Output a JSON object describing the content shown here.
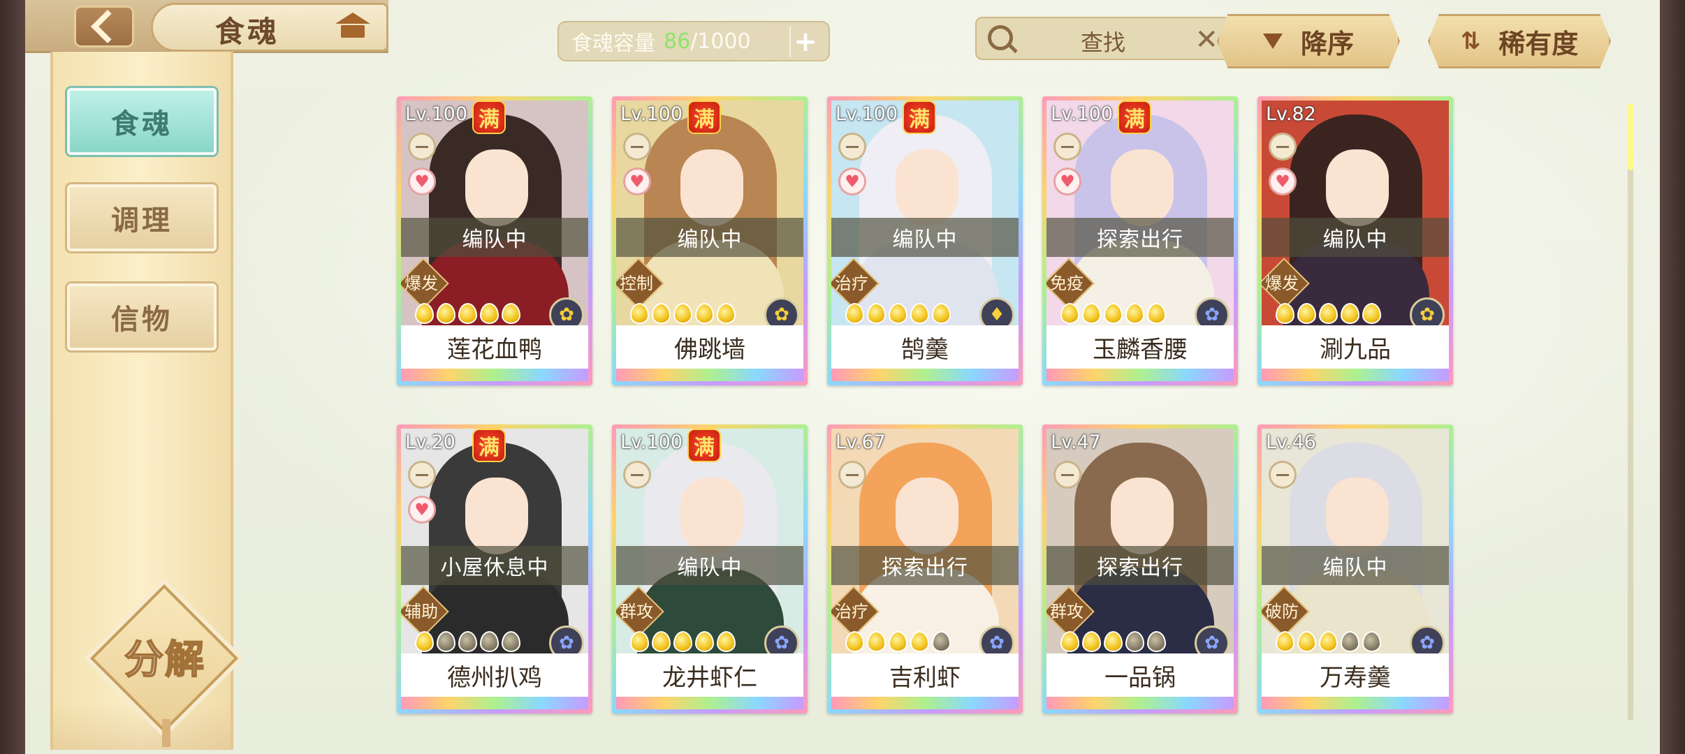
{
  "header": {
    "title": "食魂",
    "capacity_label": "食魂容量",
    "capacity_current": "86",
    "capacity_max": "/1000",
    "capacity_add": "+",
    "search_text": "查找",
    "search_clear": "✕",
    "sort_order_label": "降序",
    "sort_key_label": "稀有度",
    "sort_key_icon": "⇅"
  },
  "sidebar": {
    "items": [
      {
        "label": "食魂"
      },
      {
        "label": "调理"
      },
      {
        "label": "信物"
      }
    ],
    "decompose_label": "分解"
  },
  "cards": [
    {
      "level": "Lv.100",
      "max": "满",
      "status": "编队中",
      "role": "爆发",
      "name": "莲花血鸭",
      "stars_filled": 5,
      "element": "gold",
      "element_glyph": "✿",
      "heart": true
    },
    {
      "level": "Lv.100",
      "max": "满",
      "status": "编队中",
      "role": "控制",
      "name": "佛跳墙",
      "stars_filled": 5,
      "element": "gold",
      "element_glyph": "✿",
      "heart": true
    },
    {
      "level": "Lv.100",
      "max": "满",
      "status": "编队中",
      "role": "治疗",
      "name": "鹄羹",
      "stars_filled": 5,
      "element": "gold",
      "element_glyph": "♦",
      "heart": true
    },
    {
      "level": "Lv.100",
      "max": "满",
      "status": "探索出行",
      "role": "免疫",
      "name": "玉麟香腰",
      "stars_filled": 5,
      "element": "blue",
      "element_glyph": "✿",
      "heart": true
    },
    {
      "level": "Lv.82",
      "max": "",
      "status": "编队中",
      "role": "爆发",
      "name": "涮九品",
      "stars_filled": 5,
      "element": "gold",
      "element_glyph": "✿",
      "heart": true
    },
    {
      "level": "Lv.20",
      "max": "满",
      "status": "小屋休息中",
      "role": "辅助",
      "name": "德州扒鸡",
      "stars_filled": 1,
      "element": "blue",
      "element_glyph": "✿",
      "heart": true
    },
    {
      "level": "Lv.100",
      "max": "满",
      "status": "编队中",
      "role": "群攻",
      "name": "龙井虾仁",
      "stars_filled": 5,
      "element": "blue",
      "element_glyph": "✿",
      "heart": false
    },
    {
      "level": "Lv.67",
      "max": "",
      "status": "探索出行",
      "role": "治疗",
      "name": "吉利虾",
      "stars_filled": 4,
      "element": "blue",
      "element_glyph": "✿",
      "heart": false
    },
    {
      "level": "Lv.47",
      "max": "",
      "status": "探索出行",
      "role": "群攻",
      "name": "一品锅",
      "stars_filled": 3,
      "element": "blue",
      "element_glyph": "✿",
      "heart": false
    },
    {
      "level": "Lv.46",
      "max": "",
      "status": "编队中",
      "role": "破防",
      "name": "万寿羹",
      "stars_filled": 3,
      "element": "blue",
      "element_glyph": "✿",
      "heart": false
    }
  ],
  "palette": {
    "hair": [
      "#3a2a26",
      "#b98552",
      "#eeeef4",
      "#c9c3ea",
      "#3b2420",
      "#3a3a3a",
      "#eaeaee",
      "#f3a35a",
      "#8a6a4e",
      "#dcdce4"
    ],
    "robe": [
      "#8a1e24",
      "#f1e3b8",
      "#dfe4ef",
      "#f4f0e6",
      "#3a2a3e",
      "#2b2b2b",
      "#2e4a3a",
      "#f8f0e4",
      "#2b2d44",
      "#eae4cc"
    ],
    "bg": [
      "#d6c4c4",
      "#e8d8a0",
      "#c6e6f2",
      "#f2d8e8",
      "#c84a36",
      "#e6e6e6",
      "#d8ece6",
      "#f3d9b6",
      "#d6cbbe",
      "#e8e6d6"
    ]
  }
}
